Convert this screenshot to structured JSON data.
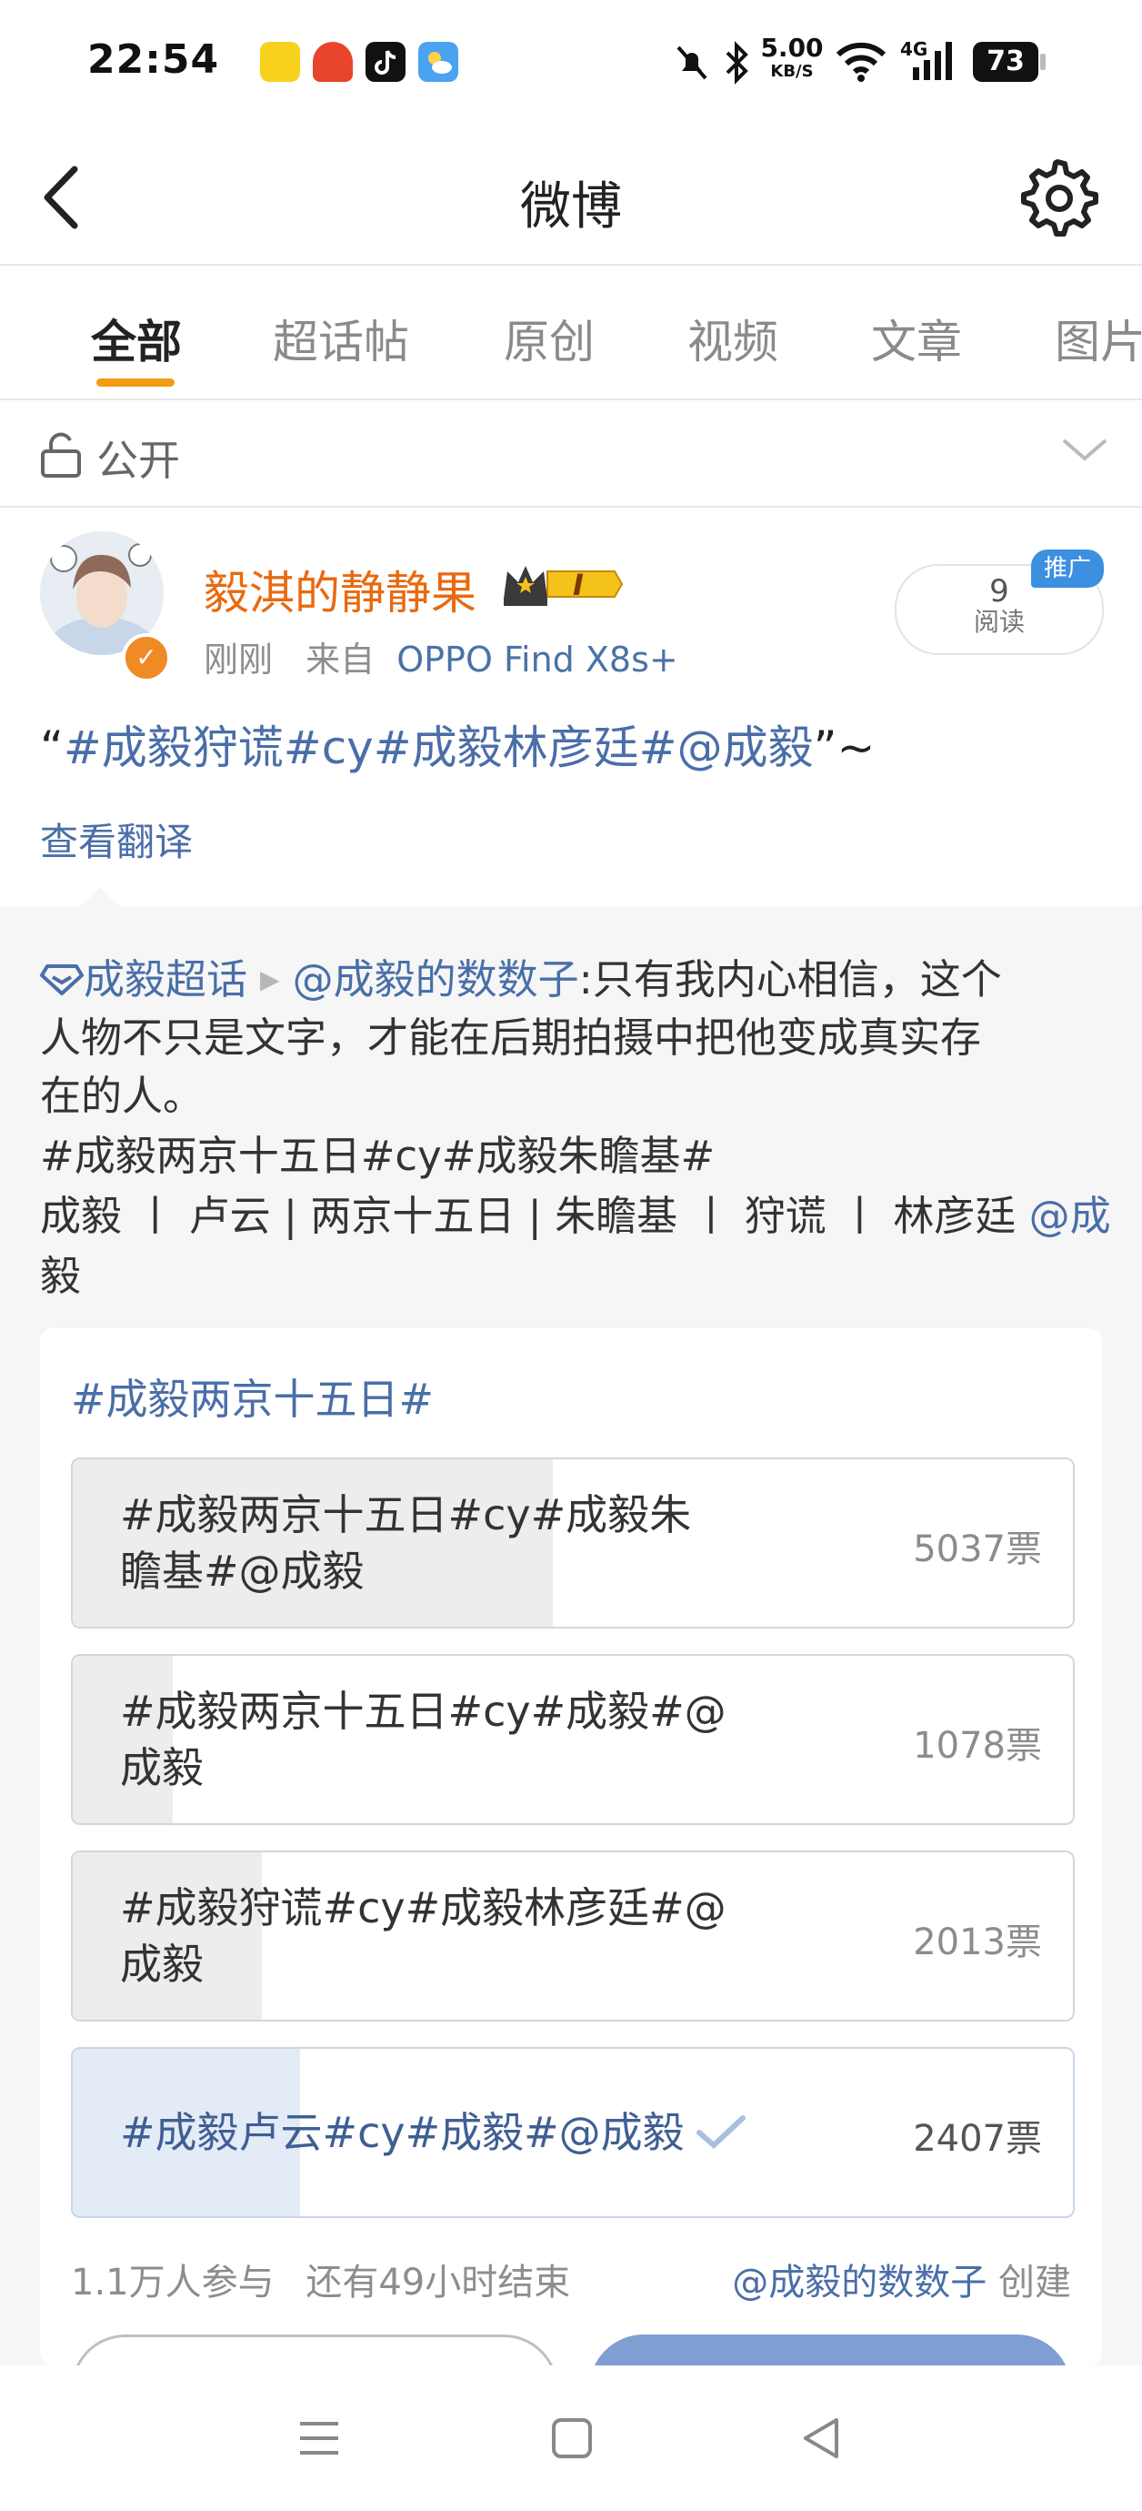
{
  "status_bar": {
    "time": "22:54",
    "speed_value": "5.00",
    "speed_unit": "KB/S",
    "network": "4G",
    "battery": "73"
  },
  "header": {
    "title": "微博"
  },
  "tabs": [
    {
      "label": "全部",
      "active": true
    },
    {
      "label": "超话帖"
    },
    {
      "label": "原创"
    },
    {
      "label": "视频"
    },
    {
      "label": "文章"
    },
    {
      "label": "图片"
    }
  ],
  "visibility": {
    "label": "公开"
  },
  "post": {
    "username": "毅淇的静静果",
    "level_badge": "I",
    "time": "刚刚",
    "source_prefix": "来自",
    "device": "OPPO Find X8s+",
    "read_count": "9",
    "read_label": "阅读",
    "promo_label": "推广",
    "text_open": "“",
    "text_tags": "#成毅狩谎#cy#成毅林彦廷#@成毅",
    "text_close": "”~",
    "translate": "查看翻译"
  },
  "repost": {
    "topic": "成毅超话",
    "author": "@成毅的数数子",
    "line1_text": ":只有我内心相信，这个",
    "line2": "人物不只是文字，才能在后期拍摄中把他变成真实存",
    "line3": "在的人。",
    "line4_tags": "#成毅两京十五日#cy#成毅朱瞻基#",
    "line5_text": "成毅 丨 卢云 | 两京十五日 | 朱瞻基  丨 狩谎 丨 林彦廷 ",
    "line5_mention": "@成",
    "line6": "毅"
  },
  "vote": {
    "title": "#成毅两京十五日#",
    "options": [
      {
        "line1": "#成毅两京十五日#cy#成毅朱",
        "line2": "瞻基#@成毅",
        "count": "5037票",
        "votes": 5037,
        "selected": false
      },
      {
        "line1": "#成毅两京十五日#cy#成毅#@",
        "line2": "成毅",
        "count": "1078票",
        "votes": 1078,
        "selected": false
      },
      {
        "line1": "#成毅狩谎#cy#成毅林彦廷#@",
        "line2": "成毅",
        "count": "2013票",
        "votes": 2013,
        "selected": false
      },
      {
        "line1": "#成毅卢云#cy#成毅#@成毅",
        "line2": "",
        "count": "2407票",
        "votes": 2407,
        "selected": true
      }
    ],
    "participants": "1.1万人参与",
    "remaining": "还有49小时结束",
    "creator_mention": "@成毅的数数子",
    "creator_suffix": "创建"
  },
  "colors": {
    "accent_orange": "#f39c12",
    "username_orange": "#e86a10",
    "link_blue": "#4a6ea8",
    "vote_button": "#7f9ed2"
  }
}
